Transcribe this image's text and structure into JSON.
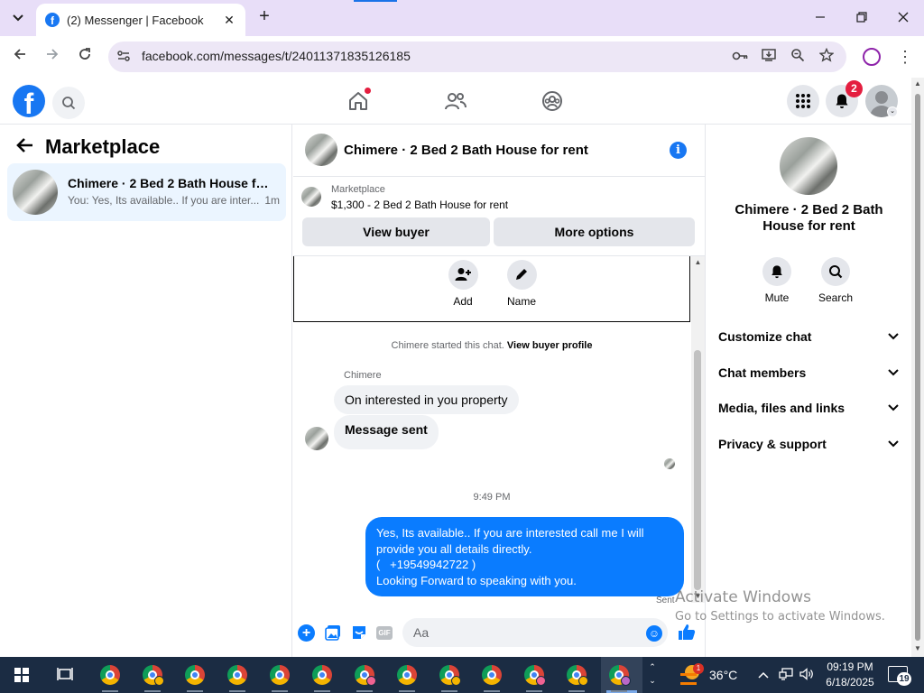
{
  "browser": {
    "tab_title": "(2) Messenger | Facebook",
    "url": "facebook.com/messages/t/24011371835126185",
    "new_tab_symbol": "+",
    "theme_color": "#e8def8"
  },
  "facebook": {
    "notification_count": "2",
    "brand_color": "#1877f2"
  },
  "left_panel": {
    "title": "Marketplace",
    "conversations": [
      {
        "name": "Chimere · 2 Bed 2 Bath House for rent",
        "preview": "You: Yes, Its available.. If you are inter...",
        "time": "1m"
      }
    ]
  },
  "chat": {
    "title": "Chimere · 2 Bed 2 Bath House for rent",
    "marketplace_label": "Marketplace",
    "listing": "$1,300 - 2 Bed 2 Bath House for rent",
    "view_buyer_label": "View buyer",
    "more_options_label": "More options",
    "actions": [
      {
        "label": "Add",
        "icon": "add-person-icon"
      },
      {
        "label": "Name",
        "icon": "pencil-icon"
      }
    ],
    "system_text": "Chimere started this chat.",
    "system_link": "View buyer profile",
    "sender_name": "Chimere",
    "incoming_messages": [
      "On interested in you property",
      "Message sent"
    ],
    "timestamp": "9:49 PM",
    "outgoing_lines": [
      "Yes, Its available.. If you are interested call me I will",
      "provide you all details directly.",
      "(   +19549942722 )",
      "Looking Forward to speaking with you."
    ],
    "status": "Sent",
    "composer_placeholder": "Aa",
    "outgoing_color": "#0a7cff"
  },
  "right_panel": {
    "title": "Chimere · 2 Bed 2 Bath House for rent",
    "actions": [
      {
        "label": "Mute",
        "icon": "bell-icon"
      },
      {
        "label": "Search",
        "icon": "search-icon"
      }
    ],
    "sections": [
      "Customize chat",
      "Chat members",
      "Media, files and links",
      "Privacy & support"
    ]
  },
  "watermark": {
    "line1": "Activate Windows",
    "line2": "Go to Settings to activate Windows."
  },
  "taskbar": {
    "temperature": "36°C",
    "time": "09:19 PM",
    "date": "6/18/2025",
    "notification_count": "19",
    "weather_alert_count": "1",
    "chrome_profile_colors": [
      "",
      "#f4b400",
      "",
      "",
      "",
      "",
      "#f06292",
      "",
      "#f4b400",
      "",
      "#f06292",
      "#f4b400",
      "#ba68c8"
    ]
  }
}
